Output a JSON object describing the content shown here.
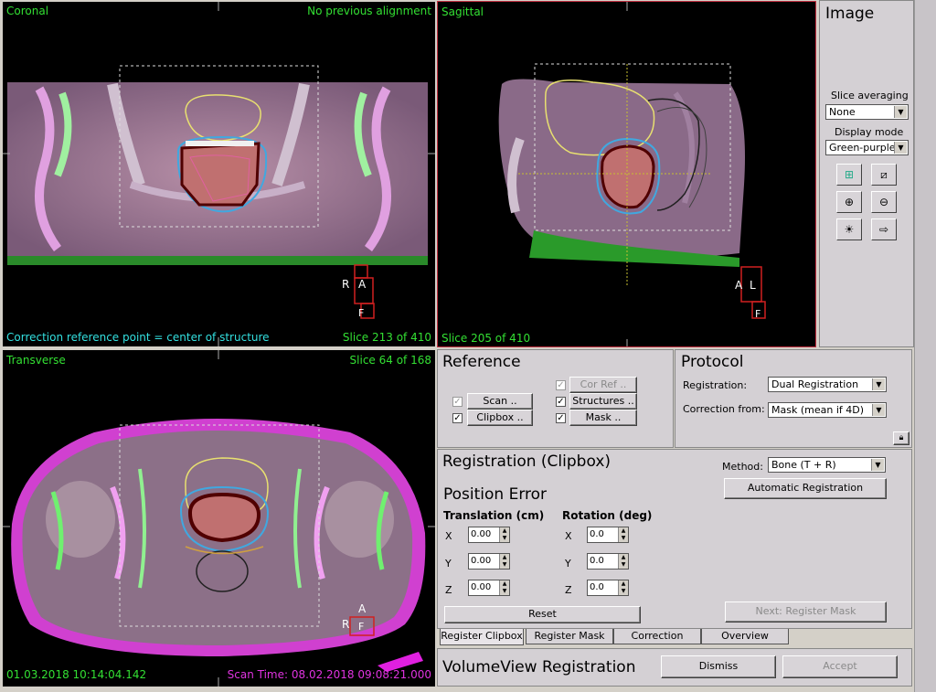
{
  "views": {
    "coronal": {
      "title": "Coronal",
      "alignment": "No previous alignment",
      "correction_ref": "Correction reference point = center of structure",
      "slice": "Slice 213 of 410",
      "orient_left": "R",
      "orient_top": "A",
      "orient_bottom": "F"
    },
    "sagittal": {
      "title": "Sagittal",
      "slice": "Slice 205 of 410",
      "orient_left": "A",
      "orient_top": "L",
      "orient_bottom": "F"
    },
    "transverse": {
      "title": "Transverse",
      "slice": "Slice 64 of 168",
      "date": "01.03.2018 10:14:04.142",
      "scan_time": "Scan Time: 08.02.2018 09:08:21.000",
      "orient_top": "A",
      "orient_left": "R",
      "orient_box": "F"
    }
  },
  "image_panel": {
    "title": "Image",
    "slice_averaging_label": "Slice averaging",
    "slice_averaging_value": "None",
    "display_mode_label": "Display mode",
    "display_mode_value": "Green-purple",
    "tools": [
      "overlay-blend-icon",
      "split-view-icon",
      "zoom-in-icon",
      "zoom-out-icon",
      "brightness-contrast-icon",
      "pointer-add-icon"
    ]
  },
  "reference": {
    "title": "Reference",
    "scan": "Scan ..",
    "clipbox": "Clipbox ..",
    "cor_ref": "Cor Ref ..",
    "structures": "Structures ..",
    "mask": "Mask .."
  },
  "protocol": {
    "title": "Protocol",
    "registration_label": "Registration:",
    "registration_value": "Dual Registration",
    "correction_label": "Correction from:",
    "correction_value": "Mask (mean if 4D)"
  },
  "registration": {
    "title": "Registration (Clipbox)",
    "method_label": "Method:",
    "method_value": "Bone (T + R)",
    "auto_button": "Automatic Registration",
    "position_error": "Position Error",
    "translation_label": "Translation (cm)",
    "rotation_label": "Rotation (deg)",
    "axes": [
      "X",
      "Y",
      "Z"
    ],
    "translation": [
      "0.00",
      "0.00",
      "0.00"
    ],
    "rotation": [
      "0.0",
      "0.0",
      "0.0"
    ],
    "reset": "Reset",
    "next_button": "Next: Register Mask"
  },
  "tabs": [
    "Register Clipbox",
    "Register Mask",
    "Correction",
    "Overview"
  ],
  "footer": {
    "title": "VolumeView Registration",
    "dismiss": "Dismiss",
    "accept": "Accept"
  }
}
